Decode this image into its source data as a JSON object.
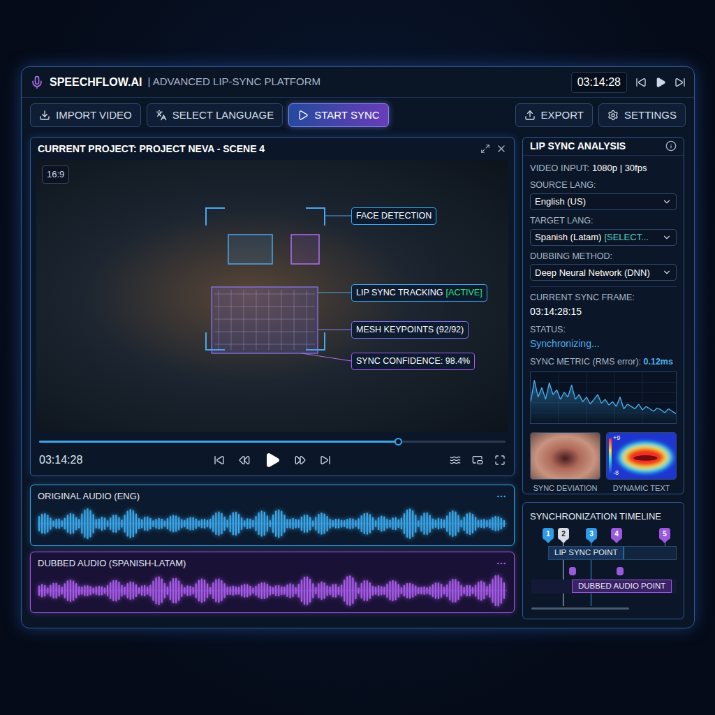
{
  "app": {
    "name": "SPEECHFLOW.AI",
    "subtitle": "| ADVANCED LIP-SYNC PLATFORM",
    "timecode": "03:14:28"
  },
  "toolbar": {
    "left": [
      {
        "label": "IMPORT VIDEO",
        "selected": false
      },
      {
        "label": "SELECT LANGUAGE",
        "selected": false
      },
      {
        "label": "START SYNC",
        "selected": true
      }
    ],
    "right": [
      {
        "label": "EXPORT"
      },
      {
        "label": "SETTINGS"
      }
    ]
  },
  "player": {
    "title": "CURRENT PROJECT: PROJECT NEVA - SCENE 4",
    "aspect": "16:9",
    "time": "03:14:28",
    "level": 0.77,
    "overlays": [
      {
        "label": "FACE DETECTION",
        "color": "#3ba6e8"
      },
      {
        "label": "LIP SYNC TRACKING",
        "status": "[ACTIVE]",
        "active": true,
        "color": "#3ba6e8"
      },
      {
        "label": "MESH KEYPOINTS (92/92)",
        "color": "#7b6ee8"
      },
      {
        "label": "SYNC CONFIDENCE: 98.4%",
        "color": "#a65ae8"
      }
    ]
  },
  "tracks": [
    {
      "label": "ORIGINAL AUDIO (ENG)",
      "color": "#3ba6e8"
    },
    {
      "label": "DUBBED AUDIO (SPANISH-LATAM)",
      "color": "#a65ae8"
    }
  ],
  "analysis": {
    "title": "LIP SYNC ANALYSIS",
    "video_input": {
      "label": "VIDEO INPUT:",
      "value": "1080p | 30fps"
    },
    "selects": [
      {
        "label": "SOURCE LANG:",
        "value": "English (US)"
      },
      {
        "label": "TARGET LANG:",
        "value": "Spanish (Latam)",
        "tag": "[SELECT..."
      },
      {
        "label": "DUBBING METHOD:",
        "value": "Deep Neural Network (DNN)"
      }
    ],
    "frame": {
      "label": "CURRENT SYNC FRAME:",
      "value": "03:14:28:15"
    },
    "status": {
      "label": "STATUS:",
      "value": "Synchronizing..."
    },
    "metric": {
      "label": "SYNC METRIC (RMS error):",
      "value": "0.12ms",
      "values": [
        0.45,
        0.9,
        0.55,
        0.75,
        0.5,
        0.85,
        0.6,
        0.7,
        0.5,
        0.65,
        0.55,
        0.8,
        0.5,
        0.6,
        0.45,
        0.55,
        0.4,
        0.5,
        0.6,
        0.42,
        0.5,
        0.38,
        0.45,
        0.35,
        0.55,
        0.3,
        0.4,
        0.35,
        0.3,
        0.4,
        0.28,
        0.35,
        0.3,
        0.25,
        0.32,
        0.28,
        0.22,
        0.3,
        0.25,
        0.2
      ]
    },
    "thumbs": [
      {
        "label": "SYNC DEVIATION",
        "kind": "photo"
      },
      {
        "label": "DYNAMIC TEXT",
        "kind": "heatmap",
        "scale_max": "+9",
        "scale_min": "-8"
      }
    ]
  },
  "timeline": {
    "title": "SYNCHRONIZATION TIMELINE",
    "markers": [
      {
        "label": "1",
        "color": "#2f9be6"
      },
      {
        "label": "2",
        "color": "#d8dde6"
      },
      {
        "label": "3",
        "color": "#2f9be6"
      },
      {
        "label": "4",
        "color": "#9b59e0"
      },
      {
        "label": "5",
        "color": "#9b59e0"
      }
    ],
    "lanes": [
      {
        "label": "LIP SYNC POINT"
      },
      {
        "label": "DUBBED AUDIO POINT"
      }
    ]
  }
}
